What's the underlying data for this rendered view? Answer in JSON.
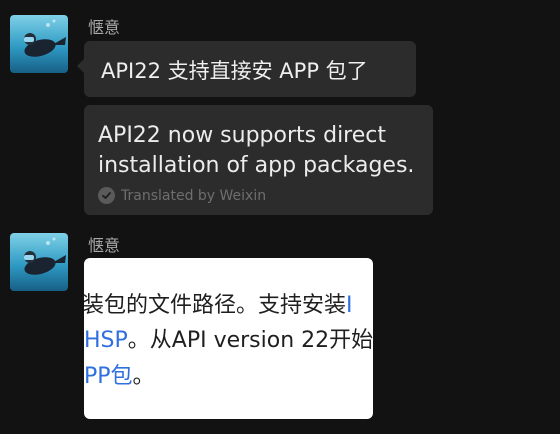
{
  "chat": {
    "messages": [
      {
        "sender": "惬意",
        "text": "API22 支持直接安 APP 包了",
        "translation": {
          "line1": "API22 now supports direct",
          "line2": "installation of app packages.",
          "credit": "Translated by Weixin"
        }
      },
      {
        "sender": "惬意",
        "image": {
          "line1": "装包的文件路径。支持安装",
          "line1_tail": "I",
          "line2_blue": "HSP",
          "line2": "。从API version 22开始",
          "line3_blue": "PP包",
          "line3": "。"
        }
      }
    ]
  },
  "colors": {
    "background": "#121212",
    "bubble": "#2c2c2c",
    "link_blue": "#2f6fe0"
  },
  "icons": {
    "avatar": "diver-avatar-icon",
    "check": "check-circle-icon"
  }
}
